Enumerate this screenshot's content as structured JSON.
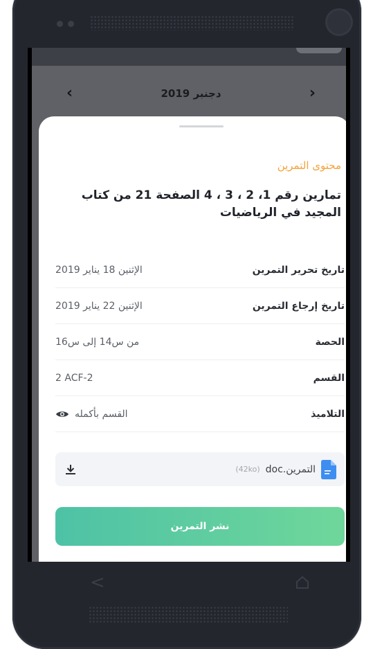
{
  "calendar": {
    "month_label": "دجنبر 2019",
    "prev_arrow": "‹",
    "next_arrow": "›"
  },
  "sheet": {
    "section_label": "محتوى التمرين",
    "title": "تمارين رقم 1، 2 ، 3 ، 4 الصفحة 21 من كتاب المجيد في الرياضيات",
    "rows": [
      {
        "label": "تاريخ تحرير التمرين",
        "value": "الإثنين 18 يناير 2019"
      },
      {
        "label": "تاريخ إرجاع التمرين",
        "value": "الإثنين 22 يناير 2019"
      },
      {
        "label": "الحصة",
        "value": "من س14 إلى س16"
      },
      {
        "label": "القسم",
        "value": "2 ACF-2"
      },
      {
        "label": "التلاميذ",
        "value": "القسم بأكمله",
        "icon": "eye-icon"
      }
    ],
    "attachment": {
      "file_name": "التمرين.doc",
      "file_size": "(42ko)",
      "file_icon": "document-icon",
      "download_icon": "download-icon"
    },
    "publish_label": "نشر التمرين"
  },
  "colors": {
    "accent_orange": "#f4a23a",
    "button_gradient_start": "#4ec2a6",
    "button_gradient_end": "#6fd79a",
    "doc_icon_blue": "#3d8ef0"
  },
  "system_nav": {
    "back_icon": "back-icon",
    "home_icon": "home-icon"
  }
}
